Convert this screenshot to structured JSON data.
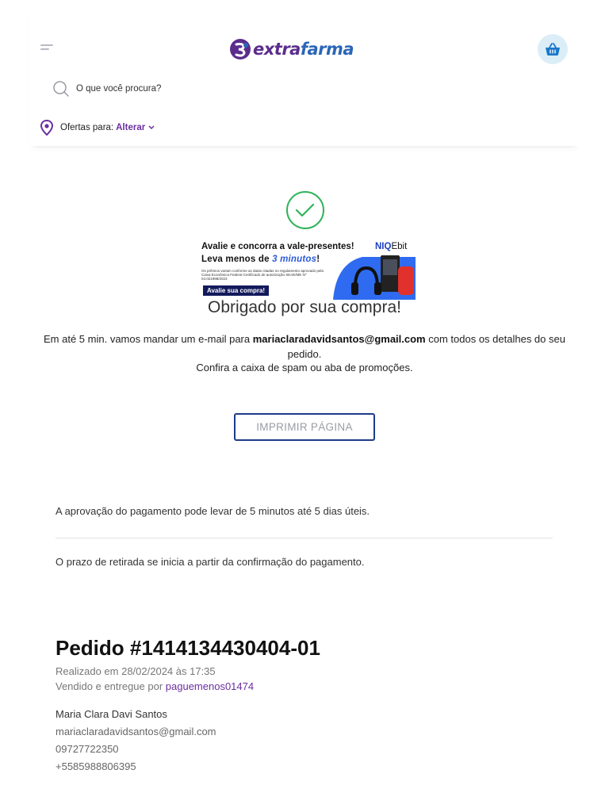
{
  "header": {
    "logo": {
      "part1": "extra",
      "part2": "farma"
    },
    "search": {
      "placeholder": "O que você procura?"
    },
    "offers": {
      "label": "Ofertas para:",
      "action": "Alterar"
    }
  },
  "banner": {
    "line1": "Avalie e concorra a vale-presentes!",
    "line2_prefix": "Leva menos de ",
    "line2_emph": "3 minutos",
    "line2_suffix": "!",
    "fine_print": "Os prêmios variam conforme as datas citadas no regulamento aprovado pela Caixa Econômica Federal Certificado de autorização SEAE/ME Nº 04.021998/2023",
    "cta": "Avalie sua compra!",
    "brand_a": "NIQ",
    "brand_b": "Ebit"
  },
  "confirmation": {
    "title": "Obrigado por sua compra!",
    "msg_prefix": "Em até 5 min. vamos mandar um e-mail para ",
    "email": "mariaclaradavidsantos@gmail.com",
    "msg_suffix": " com todos os detalhes do seu pedido.",
    "spam": "Confira a caixa de spam ou aba de promoções.",
    "print_button": "IMPRIMIR PÁGINA"
  },
  "notices": {
    "payment": "A aprovação do pagamento pode levar de 5 minutos até 5 dias úteis.",
    "pickup": "O prazo de retirada se inicia a partir da confirmação do pagamento."
  },
  "order": {
    "title": "Pedido #1414134430404-01",
    "date": "Realizado em 28/02/2024 às 17:35",
    "seller_prefix": "Vendido e entregue por ",
    "seller": "paguemenos01474"
  },
  "customer": {
    "name": "Maria Clara Davi Santos",
    "email": "mariaclaradavidsantos@gmail.com",
    "document": "09727722350",
    "phone": "+5585988806395"
  },
  "colors": {
    "brand_purple": "#6b2fa0",
    "brand_blue": "#2a66b8",
    "success_green": "#2fb35a",
    "button_border": "#1d3b8a"
  }
}
